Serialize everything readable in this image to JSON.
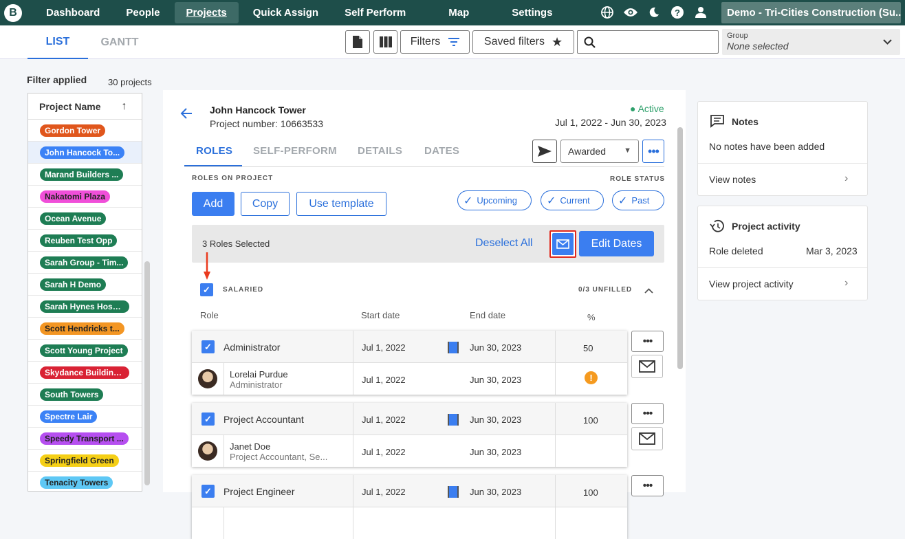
{
  "nav": {
    "logo": "B",
    "items": [
      "Dashboard",
      "People",
      "Projects",
      "Quick Assign",
      "Self Perform",
      "Map",
      "Settings"
    ],
    "active_index": 2,
    "org": "Demo - Tri-Cities Construction (Su..."
  },
  "subbar": {
    "tab_list": "LIST",
    "tab_gantt": "GANTT",
    "filters_label": "Filters",
    "saved_filters_label": "Saved filters",
    "search_placeholder": "",
    "group_label": "Group",
    "group_value": "None selected"
  },
  "left": {
    "filter_applied": "Filter applied",
    "project_count": "30 projects",
    "column_header": "Project Name",
    "projects": [
      {
        "name": "Gordon Tower",
        "color": "#e0561c",
        "dark": false
      },
      {
        "name": "John Hancock To...",
        "color": "#3b82f6",
        "dark": false,
        "selected": true
      },
      {
        "name": "Marand Builders ...",
        "color": "#1e7d54",
        "dark": false
      },
      {
        "name": "Nakatomi Plaza",
        "color": "#f04fd9",
        "dark": true
      },
      {
        "name": "Ocean Avenue",
        "color": "#1e7d54",
        "dark": false
      },
      {
        "name": "Reuben Test Opp",
        "color": "#1e7d54",
        "dark": false
      },
      {
        "name": "Sarah Group - Tim...",
        "color": "#1e7d54",
        "dark": false
      },
      {
        "name": "Sarah H Demo",
        "color": "#1e7d54",
        "dark": false
      },
      {
        "name": "Sarah Hynes Hosp...",
        "color": "#1e7d54",
        "dark": false
      },
      {
        "name": "Scott Hendricks t...",
        "color": "#f39624",
        "dark": true
      },
      {
        "name": "Scott Young Project",
        "color": "#1e7d54",
        "dark": false
      },
      {
        "name": "Skydance Building...",
        "color": "#d92234",
        "dark": false
      },
      {
        "name": "South Towers",
        "color": "#1e7d54",
        "dark": false
      },
      {
        "name": "Spectre Lair",
        "color": "#3b82f6",
        "dark": false
      },
      {
        "name": "Speedy Transport ...",
        "color": "#b64ff0",
        "dark": true
      },
      {
        "name": "Springfield Green",
        "color": "#f5cf16",
        "dark": true
      },
      {
        "name": "Tenacity Towers",
        "color": "#5ec8f5",
        "dark": true
      }
    ]
  },
  "project": {
    "title": "John Hancock Tower",
    "number": "Project number: 10663533",
    "status": "● Active",
    "dates": "Jul 1, 2022 - Jun 30, 2023",
    "tabs": [
      "ROLES",
      "SELF-PERFORM",
      "DETAILS",
      "DATES"
    ],
    "award_status": "Awarded",
    "roles_on_project": "ROLES ON PROJECT",
    "role_status": "ROLE STATUS",
    "add": "Add",
    "copy": "Copy",
    "use_template": "Use template",
    "chips": [
      "Upcoming",
      "Current",
      "Past"
    ],
    "selected_text": "3 Roles Selected",
    "deselect_all": "Deselect All",
    "edit_dates": "Edit Dates",
    "group_name": "SALARIED",
    "unfilled": "0/3 UNFILLED",
    "col_role": "Role",
    "col_start": "Start date",
    "col_end": "End date",
    "col_pct": "%",
    "roles": [
      {
        "role": "Administrator",
        "start": "Jul 1, 2022",
        "end": "Jun 30, 2023",
        "pct": "50",
        "person": "Lorelai Purdue",
        "person_role": "Administrator",
        "p_start": "Jul 1, 2022",
        "p_end": "Jun 30, 2023",
        "warn": "!"
      },
      {
        "role": "Project Accountant",
        "start": "Jul 1, 2022",
        "end": "Jun 30, 2023",
        "pct": "100",
        "person": "Janet Doe",
        "person_role": "Project Accountant, Se...",
        "p_start": "Jul 1, 2022",
        "p_end": "Jun 30, 2023",
        "warn": ""
      },
      {
        "role": "Project Engineer",
        "start": "Jul 1, 2022",
        "end": "Jun 30, 2023",
        "pct": "100",
        "person": "",
        "person_role": "",
        "p_start": "",
        "p_end": "",
        "warn": ""
      }
    ]
  },
  "right": {
    "notes_title": "Notes",
    "notes_empty": "No notes have been added",
    "view_notes": "View notes",
    "activity_title": "Project activity",
    "activity_item": "Role deleted",
    "activity_date": "Mar 3, 2023",
    "view_activity": "View project activity"
  }
}
